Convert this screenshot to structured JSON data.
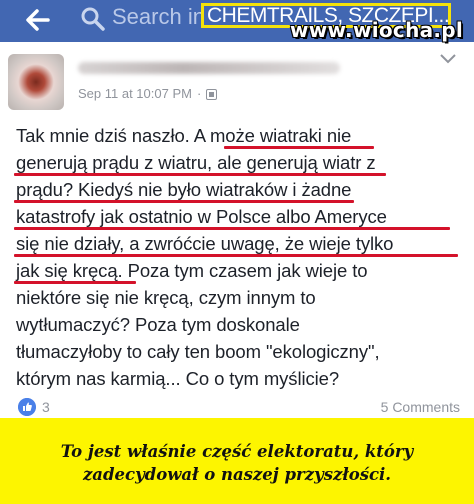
{
  "search": {
    "placeholder": "Search in",
    "query": "CHEMTRAILS, SZCZEPI..."
  },
  "watermark": "www.wiocha.pl",
  "post": {
    "author_name": "",
    "timestamp": "Sep 11 at 10:07 PM",
    "separator": "·",
    "lines": [
      "Tak mnie dziś naszło. A może wiatraki nie",
      "generują prądu z wiatru, ale generują wiatr z",
      "prądu? Kiedyś nie było wiatraków i żadne",
      "katastrofy jak ostatnio w Polsce albo Ameryce",
      "się nie działy, a zwróćcie uwagę, że wieje tylko",
      "jak się kręcą. Poza tym czasem jak wieje to",
      "niektóre się nie kręcą, czym innym to",
      "wytłumaczyć? Poza tym doskonale",
      "tłumaczyłoby to cały ten boom \"ekologiczny\",",
      "którym nas karmią... Co o tym myślicie?"
    ],
    "likes": "3",
    "comments": "5 Comments"
  },
  "caption": {
    "line1": "To jest właśnie część elektoratu, który",
    "line2": "zadecydował o naszej przyszłości."
  },
  "colors": {
    "header_bg": "#4267b2",
    "highlight_border": "#f4e20a",
    "underline": "#d4122a",
    "caption_bg": "#fdf500",
    "like_blue": "#4a80e8"
  },
  "icons": [
    "back-arrow-icon",
    "search-icon",
    "globe-icon",
    "chevron-down-icon",
    "like-icon"
  ]
}
